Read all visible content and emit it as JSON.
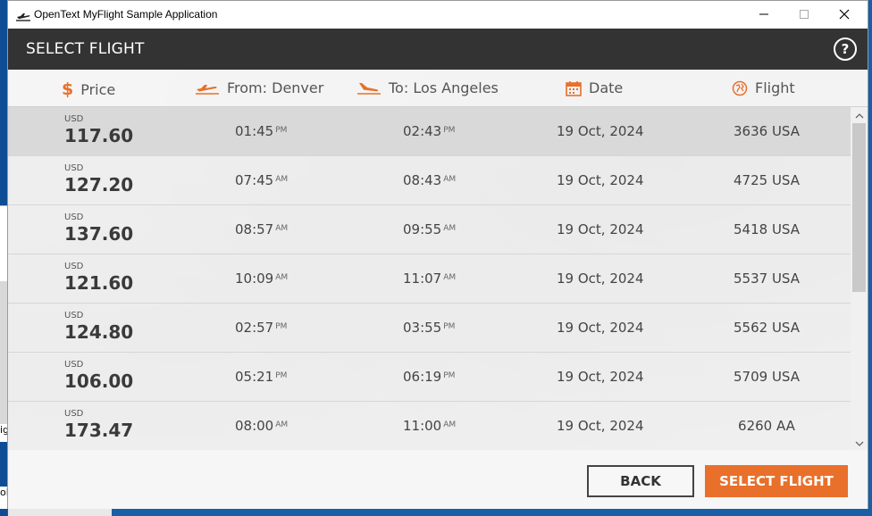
{
  "window": {
    "title": "OpenText MyFlight Sample Application"
  },
  "header": {
    "title": "SELECT FLIGHT",
    "help_label": "?"
  },
  "columns": {
    "price": "Price",
    "from": "From: Denver",
    "to": "To: Los Angeles",
    "date": "Date",
    "flight": "Flight"
  },
  "flights": [
    {
      "currency": "USD",
      "price": "117.60",
      "dep_time": "01:45",
      "dep_ampm": "PM",
      "arr_time": "02:43",
      "arr_ampm": "PM",
      "date": "19 Oct, 2024",
      "flight": "3636 USA",
      "selected": true
    },
    {
      "currency": "USD",
      "price": "127.20",
      "dep_time": "07:45",
      "dep_ampm": "AM",
      "arr_time": "08:43",
      "arr_ampm": "AM",
      "date": "19 Oct, 2024",
      "flight": "4725 USA"
    },
    {
      "currency": "USD",
      "price": "137.60",
      "dep_time": "08:57",
      "dep_ampm": "AM",
      "arr_time": "09:55",
      "arr_ampm": "AM",
      "date": "19 Oct, 2024",
      "flight": "5418 USA"
    },
    {
      "currency": "USD",
      "price": "121.60",
      "dep_time": "10:09",
      "dep_ampm": "AM",
      "arr_time": "11:07",
      "arr_ampm": "AM",
      "date": "19 Oct, 2024",
      "flight": "5537 USA"
    },
    {
      "currency": "USD",
      "price": "124.80",
      "dep_time": "02:57",
      "dep_ampm": "PM",
      "arr_time": "03:55",
      "arr_ampm": "PM",
      "date": "19 Oct, 2024",
      "flight": "5562 USA"
    },
    {
      "currency": "USD",
      "price": "106.00",
      "dep_time": "05:21",
      "dep_ampm": "PM",
      "arr_time": "06:19",
      "arr_ampm": "PM",
      "date": "19 Oct, 2024",
      "flight": "5709 USA"
    },
    {
      "currency": "USD",
      "price": "173.47",
      "dep_time": "08:00",
      "dep_ampm": "AM",
      "arr_time": "11:00",
      "arr_ampm": "AM",
      "date": "19 Oct, 2024",
      "flight": "6260 AA"
    }
  ],
  "footer": {
    "back_label": "BACK",
    "select_label": "SELECT FLIGHT"
  },
  "desktop": {
    "frag1": "ig",
    "frag2": "ol"
  },
  "colors": {
    "accent": "#e8702a",
    "header_bg": "#333333",
    "selected_row": "#d9d9d9"
  },
  "icons": {
    "app": "airplane-takeoff-icon",
    "price": "dollar-icon",
    "from": "takeoff-icon",
    "to": "landing-icon",
    "date": "calendar-icon",
    "flight": "globe-icon"
  }
}
